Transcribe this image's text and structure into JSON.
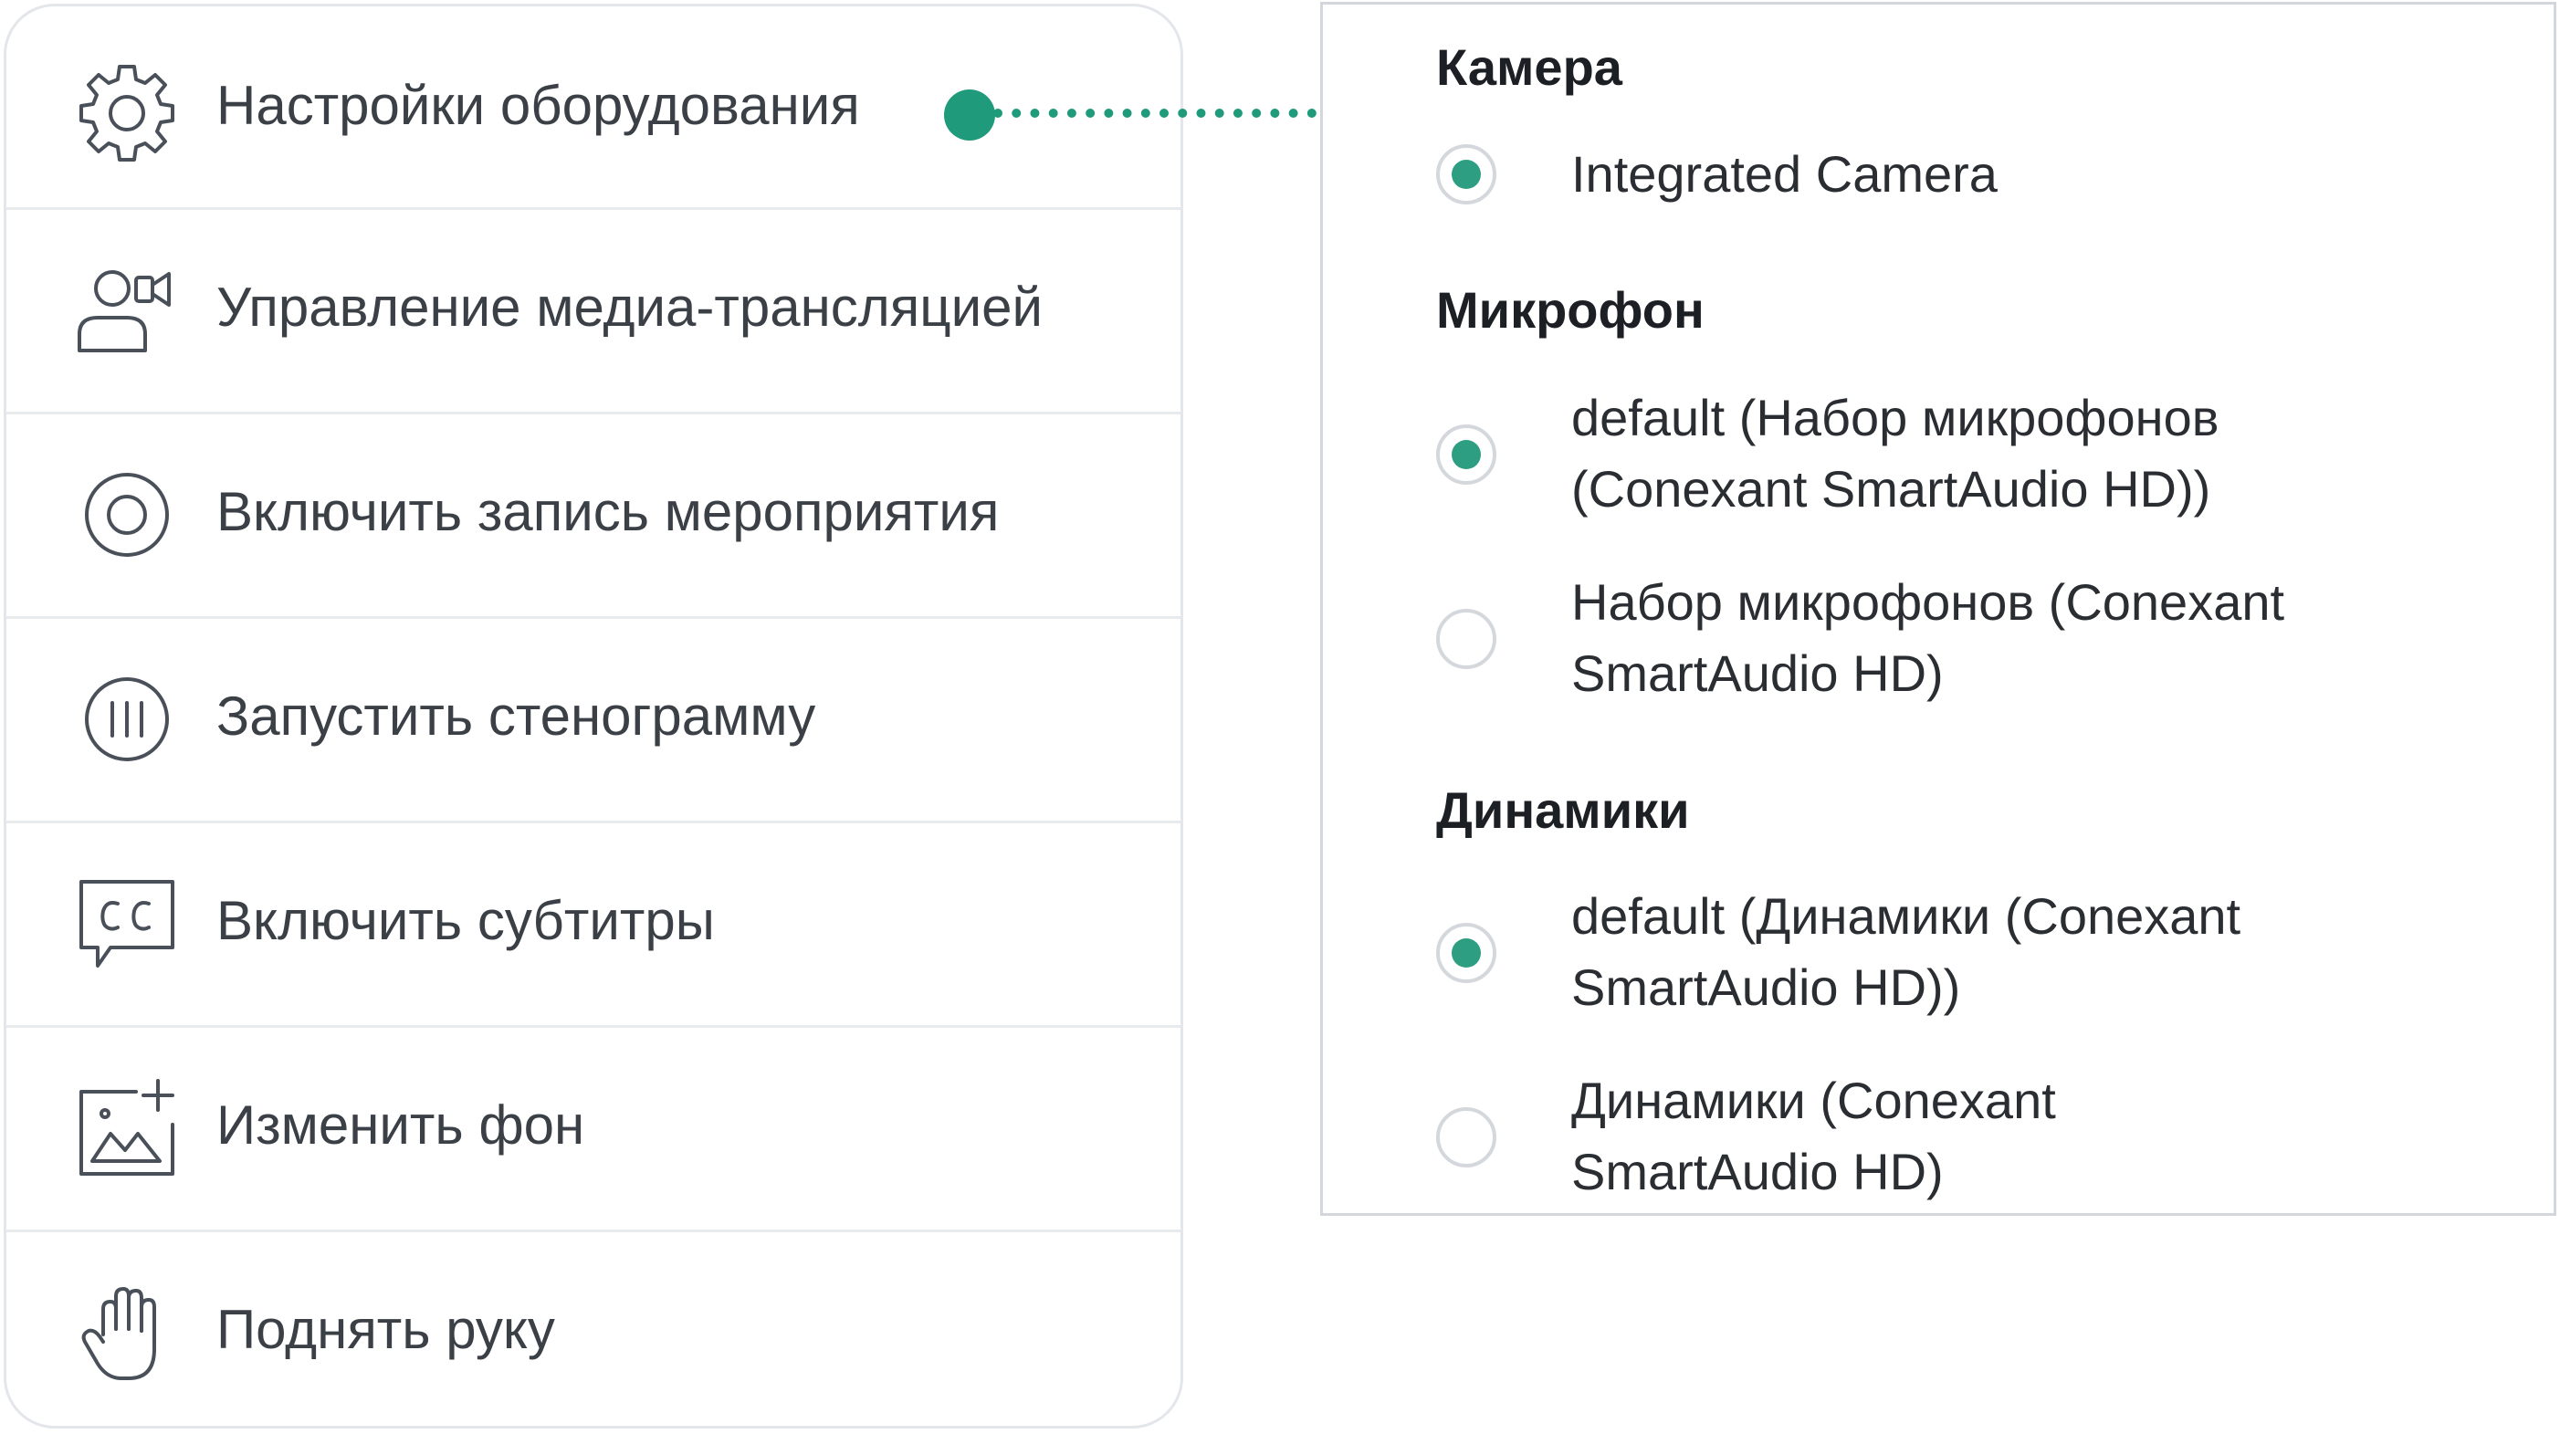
{
  "menu": {
    "items": [
      {
        "label": "Настройки оборудования",
        "icon": "gear-icon"
      },
      {
        "label": "Управление медиа-трансляцией",
        "icon": "media-broadcast-icon"
      },
      {
        "label": "Включить запись мероприятия",
        "icon": "record-icon"
      },
      {
        "label": "Запустить стенограмму",
        "icon": "transcript-icon"
      },
      {
        "label": "Включить субтитры",
        "icon": "subtitles-icon"
      },
      {
        "label": "Изменить фон",
        "icon": "change-background-icon"
      },
      {
        "label": "Поднять руку",
        "icon": "raise-hand-icon"
      }
    ]
  },
  "panel": {
    "camera": {
      "title": "Камера",
      "options": [
        {
          "label": "Integrated Camera",
          "checked": true
        }
      ]
    },
    "microphone": {
      "title": "Микрофон",
      "options": [
        {
          "line1": "default (Набор микрофонов",
          "line2": "(Conexant SmartAudio HD))",
          "checked": true
        },
        {
          "line1": "Набор микрофонов (Conexant",
          "line2": "SmartAudio HD)",
          "checked": false
        }
      ]
    },
    "speakers": {
      "title": "Динамики",
      "options": [
        {
          "line1": "default (Динамики (Conexant",
          "line2": "SmartAudio HD))",
          "checked": true
        },
        {
          "line1": "Динамики (Conexant",
          "line2": "SmartAudio HD)",
          "checked": false
        }
      ]
    }
  },
  "colors": {
    "accent": "#1f9a7b",
    "text": "#3b4047",
    "border": "#e3e6ea"
  }
}
